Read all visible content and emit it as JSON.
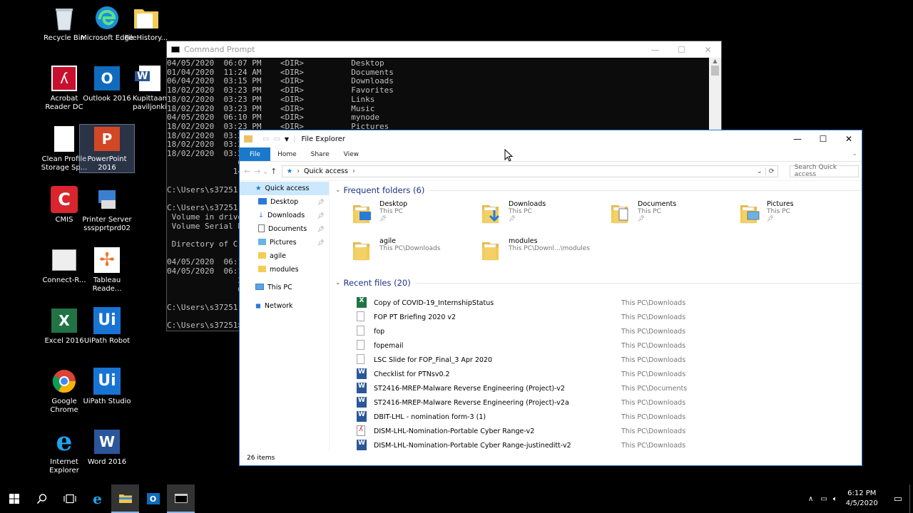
{
  "desktop": {
    "icons": [
      {
        "label": "Recycle Bin",
        "icon": "recycle-bin-icon"
      },
      {
        "label": "Microsoft Edge",
        "icon": "edge-icon"
      },
      {
        "label": "FileHistory...",
        "icon": "folder-icon"
      },
      {
        "label": "Acrobat Reader DC",
        "icon": "acrobat-icon"
      },
      {
        "label": "Outlook 2016",
        "icon": "outlook-icon"
      },
      {
        "label": "Kupittaan paviljonki",
        "icon": "word-doc-icon"
      },
      {
        "label": "Clean Profile Storage Sp...",
        "icon": "blank-file-icon"
      },
      {
        "label": "PowerPoint 2016",
        "icon": "powerpoint-icon"
      },
      {
        "label": "CMIS",
        "icon": "cmis-icon"
      },
      {
        "label": "Printer Server ssspprtprd02",
        "icon": "printer-icon"
      },
      {
        "label": "Connect-R...",
        "icon": "connect-icon"
      },
      {
        "label": "Tableau Reade...",
        "icon": "tableau-icon"
      },
      {
        "label": "Excel 2016",
        "icon": "excel-icon"
      },
      {
        "label": "UiPath Robot",
        "icon": "uipath-icon"
      },
      {
        "label": "Google Chrome",
        "icon": "chrome-icon"
      },
      {
        "label": "UiPath Studio",
        "icon": "uipath-icon"
      },
      {
        "label": "Internet Explorer",
        "icon": "ie-icon"
      },
      {
        "label": "Word 2016",
        "icon": "word-icon"
      }
    ]
  },
  "cmd": {
    "title": "Command Prompt",
    "lines": "04/05/2020  06:07 PM    <DIR>          Desktop\n01/04/2020  11:24 AM    <DIR>          Documents\n06/04/2020  03:15 PM    <DIR>          Downloads\n18/02/2020  03:23 PM    <DIR>          Favorites\n18/02/2020  03:23 PM    <DIR>          Links\n18/02/2020  03:23 PM    <DIR>          Music\n04/05/2020  06:10 PM    <DIR>          mynode\n18/02/2020  03:23 PM    <DIR>          Pictures\n18/02/2020  03:2\n18/02/2020  03:2\n18/02/2020  03:2\n               0\n              14\n\nC:\\Users\\s37251\n\nC:\\Users\\s37251\n Volume in drive\n Volume Serial N\n\n Directory of C:\n\n04/05/2020  06:1\n04/05/2020  06:1\n               2\n               0\n\nC:\\Users\\s37251\n\nC:\\Users\\s37251>"
  },
  "explorer": {
    "title": "File Explorer",
    "tabs": [
      "File",
      "Home",
      "Share",
      "View"
    ],
    "address": "Quick access",
    "search_placeholder": "Search Quick access",
    "nav": [
      {
        "label": "Quick access",
        "pinned": false
      },
      {
        "label": "Desktop",
        "pinned": true
      },
      {
        "label": "Downloads",
        "pinned": true
      },
      {
        "label": "Documents",
        "pinned": true
      },
      {
        "label": "Pictures",
        "pinned": true
      },
      {
        "label": "agile",
        "pinned": false
      },
      {
        "label": "modules",
        "pinned": false
      },
      {
        "label": "This PC",
        "pinned": false
      },
      {
        "label": "Network",
        "pinned": false
      }
    ],
    "frequent_header": "Frequent folders (6)",
    "frequent": [
      {
        "name": "Desktop",
        "loc": "This PC",
        "pinned": true
      },
      {
        "name": "Downloads",
        "loc": "This PC",
        "pinned": true
      },
      {
        "name": "Documents",
        "loc": "This PC",
        "pinned": true
      },
      {
        "name": "Pictures",
        "loc": "This PC",
        "pinned": true
      },
      {
        "name": "agile",
        "loc": "This PC\\Downloads",
        "pinned": false
      },
      {
        "name": "modules",
        "loc": "This PC\\Downl...\\modules",
        "pinned": false
      }
    ],
    "recent_header": "Recent files (20)",
    "recent": [
      {
        "name": "Copy of COVID-19_InternshipStatus",
        "loc": "This PC\\Downloads",
        "type": "excel"
      },
      {
        "name": "FOP PT Briefing 2020 v2",
        "loc": "This PC\\Downloads",
        "type": "file"
      },
      {
        "name": "fop",
        "loc": "This PC\\Downloads",
        "type": "file"
      },
      {
        "name": "fopemail",
        "loc": "This PC\\Downloads",
        "type": "file"
      },
      {
        "name": "LSC Slide for FOP_Final_3 Apr 2020",
        "loc": "This PC\\Downloads",
        "type": "file"
      },
      {
        "name": "Checklist for PTNsv0.2",
        "loc": "This PC\\Downloads",
        "type": "word"
      },
      {
        "name": "ST2416-MREP-Malware Reverse Engineering (Project)-v2",
        "loc": "This PC\\Documents",
        "type": "word"
      },
      {
        "name": "ST2416-MREP-Malware Reverse Engineering (Project)-v2a",
        "loc": "This PC\\Downloads",
        "type": "word"
      },
      {
        "name": "DBIT-LHL -  nomination form-3 (1)",
        "loc": "This PC\\Downloads",
        "type": "word"
      },
      {
        "name": "DISM-LHL-Nomination-Portable Cyber Range-v2",
        "loc": "This PC\\Downloads",
        "type": "pdf"
      },
      {
        "name": "DISM-LHL-Nomination-Portable Cyber Range-justineditt-v2",
        "loc": "This PC\\Downloads",
        "type": "word"
      }
    ],
    "status": "26 items"
  },
  "taskbar": {
    "time": "6:12 PM",
    "date": "4/5/2020"
  }
}
